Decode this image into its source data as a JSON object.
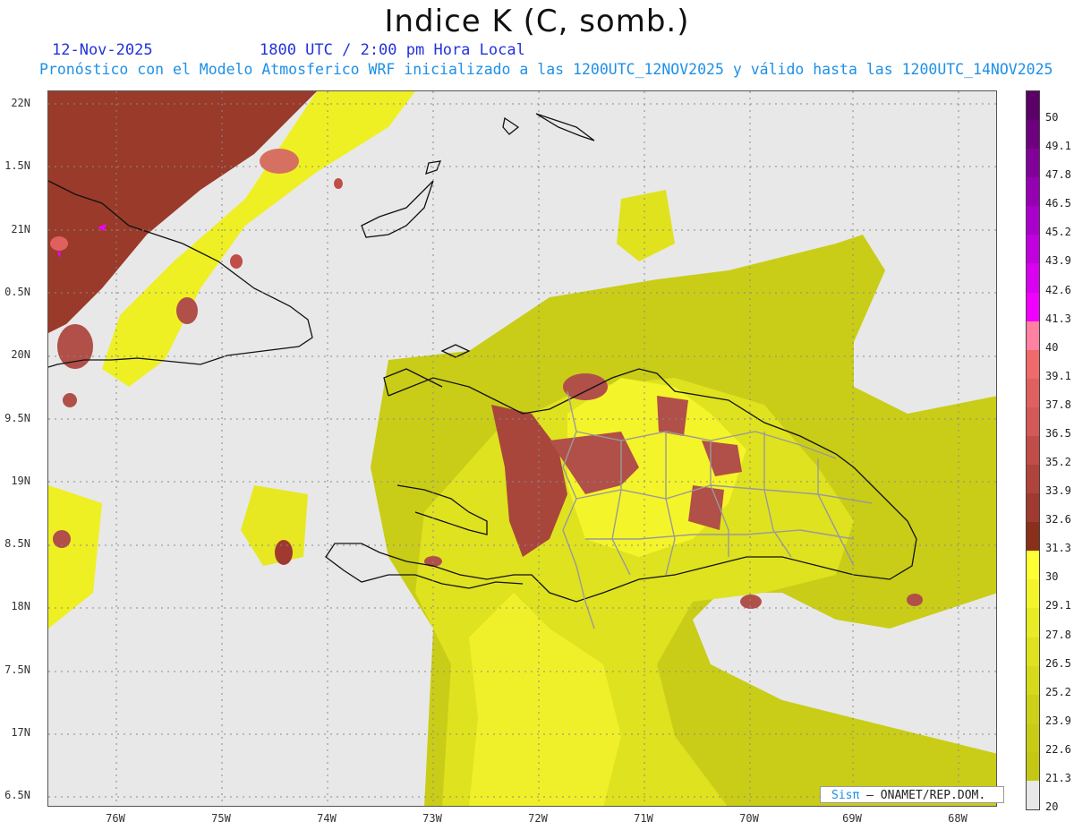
{
  "title": "Indice K (C, somb.)",
  "date_label": "12-Nov-2025",
  "time_label": "1800 UTC / 2:00 pm Hora Local",
  "forecast_label": "Pronóstico con el Modelo Atmosferico WRF inicializado a las 1200UTC_12NOV2025 y válido hasta las  1200UTC_14NOV2025",
  "lat_labels": [
    "22N",
    "1.5N",
    "21N",
    "0.5N",
    "20N",
    "9.5N",
    "19N",
    "8.5N",
    "18N",
    "7.5N",
    "17N",
    "6.5N"
  ],
  "lon_labels": [
    "76W",
    "75W",
    "74W",
    "73W",
    "72W",
    "71W",
    "70W",
    "69W",
    "68W"
  ],
  "colorbar": {
    "labels": [
      "50",
      "49.1",
      "47.8",
      "46.5",
      "45.2",
      "43.9",
      "42.6",
      "41.3",
      "40",
      "39.1",
      "37.8",
      "36.5",
      "35.2",
      "33.9",
      "32.6",
      "31.3",
      "30",
      "29.1",
      "27.8",
      "26.5",
      "25.2",
      "23.9",
      "22.6",
      "21.3",
      "20"
    ],
    "colors": [
      "#5a0066",
      "#6e0080",
      "#82009a",
      "#9600b3",
      "#aa00cc",
      "#c000dd",
      "#d800ee",
      "#f000ff",
      "#ff80a0",
      "#f06a6a",
      "#e06060",
      "#d45858",
      "#c24c48",
      "#b0443c",
      "#a03a30",
      "#8a2f1a",
      "#ffff33",
      "#f4f42a",
      "#e9eb24",
      "#dfe21f",
      "#d6da1b",
      "#cdd218",
      "#c8cc16",
      "#c4c814",
      "#e8e8e8"
    ]
  },
  "credit": {
    "brand": "Sisπ",
    "text": "– ONAMET/REP.DOM."
  }
}
